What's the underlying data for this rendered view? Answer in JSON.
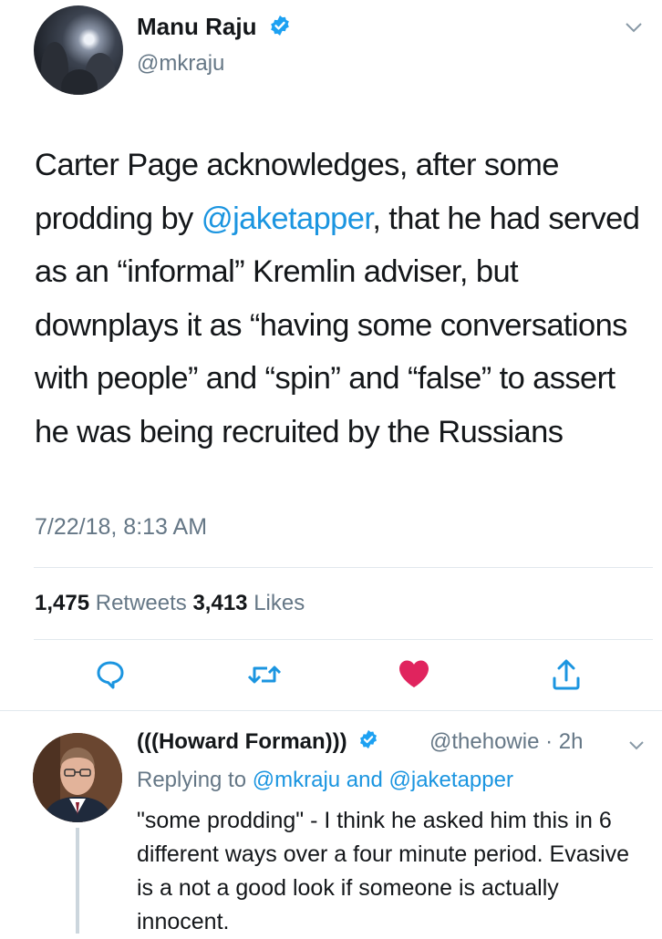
{
  "tweet": {
    "author_name": "Manu Raju",
    "author_handle": "@mkraju",
    "text_1": "Carter Page acknowledges, after some prodding by ",
    "mention": "@jaketapper",
    "text_2": ", that he had served as an “informal” Kremlin adviser, but downplays it as “having some conversations with people” and “spin” and “false” to assert he was being recruited by the Russians",
    "timestamp": "7/22/18, 8:13 AM",
    "retweets_count": "1,475",
    "retweets_label": "Retweets",
    "likes_count": "3,413",
    "likes_label": "Likes"
  },
  "actions": {
    "reply_icon": "reply-icon",
    "retweet_icon": "retweet-icon",
    "like_icon": "heart-icon",
    "share_icon": "share-icon",
    "liked": true
  },
  "reply": {
    "author_name": "(((Howard Forman)))",
    "author_handle": "@thehowie",
    "time": "· 2h",
    "replying_prefix": "Replying to",
    "replying_to_1": "@mkraju",
    "replying_and": "and",
    "replying_to_2": "@jaketapper",
    "text": "\"some prodding\"  - I think he asked him this in 6 different ways over a four minute period. Evasive is a not a good look if someone is actually innocent."
  },
  "colors": {
    "accent": "#1b95e0",
    "like": "#e0245e",
    "secondary_text": "#657786",
    "primary_text": "#14171a"
  }
}
